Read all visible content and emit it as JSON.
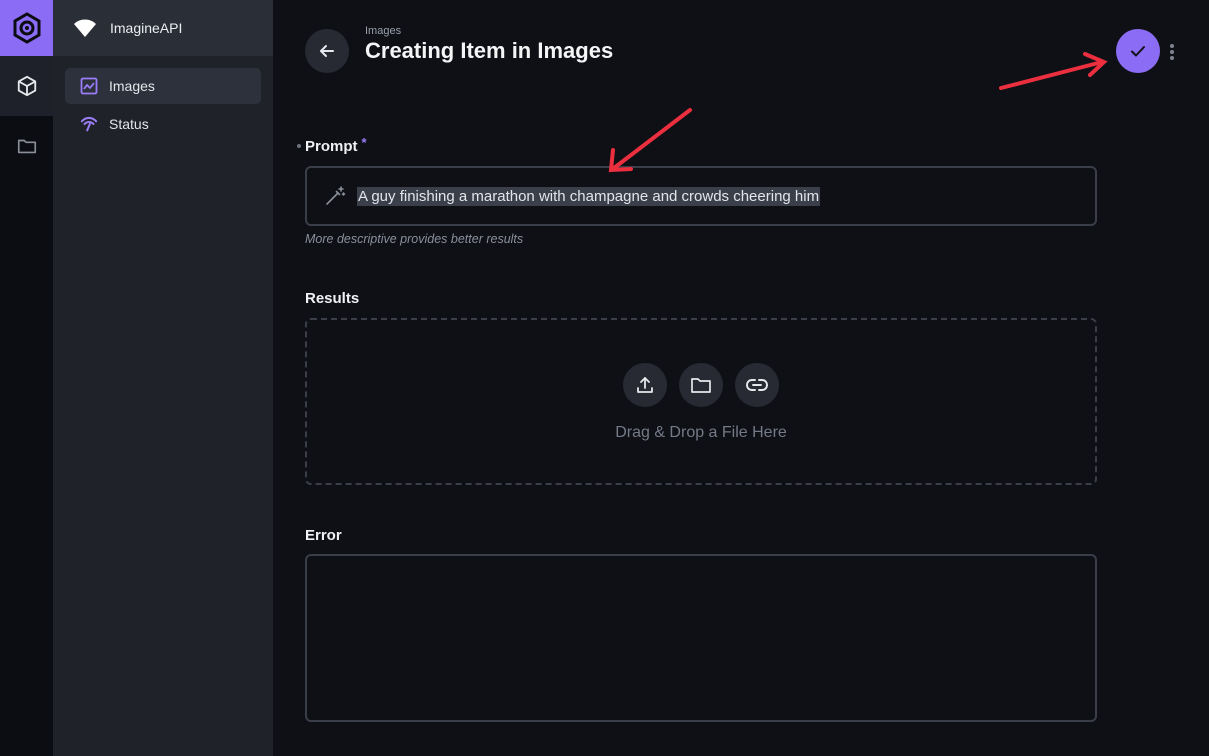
{
  "app": {
    "project_name": "ImagineAPI",
    "colors": {
      "accent": "#8b6cf5",
      "annotation": "#ec2f3e"
    }
  },
  "modules": [
    {
      "icon": "box-icon",
      "active": true
    },
    {
      "icon": "folder-icon",
      "active": false
    }
  ],
  "nav": {
    "items": [
      {
        "label": "Images",
        "icon": "image-chart-icon",
        "active": true
      },
      {
        "label": "Status",
        "icon": "signal-icon",
        "active": false
      }
    ]
  },
  "header": {
    "breadcrumb": "Images",
    "title": "Creating Item in Images"
  },
  "form": {
    "prompt": {
      "label": "Prompt",
      "required_mark": "*",
      "value": "A guy finishing a marathon with champagne and crowds cheering him",
      "hint": "More descriptive provides better results"
    },
    "results": {
      "label": "Results",
      "dropzone_text": "Drag & Drop a File Here"
    },
    "error": {
      "label": "Error",
      "value": ""
    }
  }
}
